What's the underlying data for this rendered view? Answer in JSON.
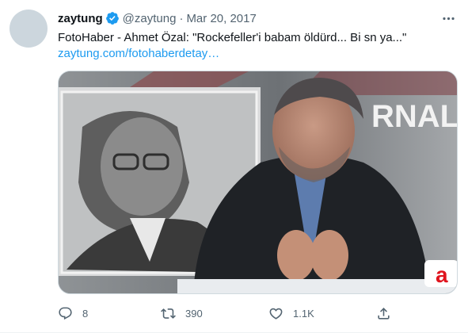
{
  "tweet": {
    "display_name": "zaytung",
    "handle": "@zaytung",
    "separator": "·",
    "date": "Mar 20, 2017",
    "text": "FotoHaber - Ahmet Özal: \"Rockefeller'i babam öldürd... Bi sn ya...\"",
    "link": "zaytung.com/fotohaberdetay…",
    "media_overlay_text": "RNAL",
    "channel_logo_text": "a",
    "reply_count": "8",
    "retweet_count": "390",
    "like_count": "1.1K"
  },
  "icons": {
    "verified": "verified-badge-icon",
    "more": "more-options-icon",
    "reply": "reply-icon",
    "retweet": "retweet-icon",
    "like": "like-icon",
    "share": "share-icon"
  },
  "colors": {
    "accent": "#1d9bf0",
    "secondary_text": "#536471",
    "primary_text": "#0f1419"
  }
}
